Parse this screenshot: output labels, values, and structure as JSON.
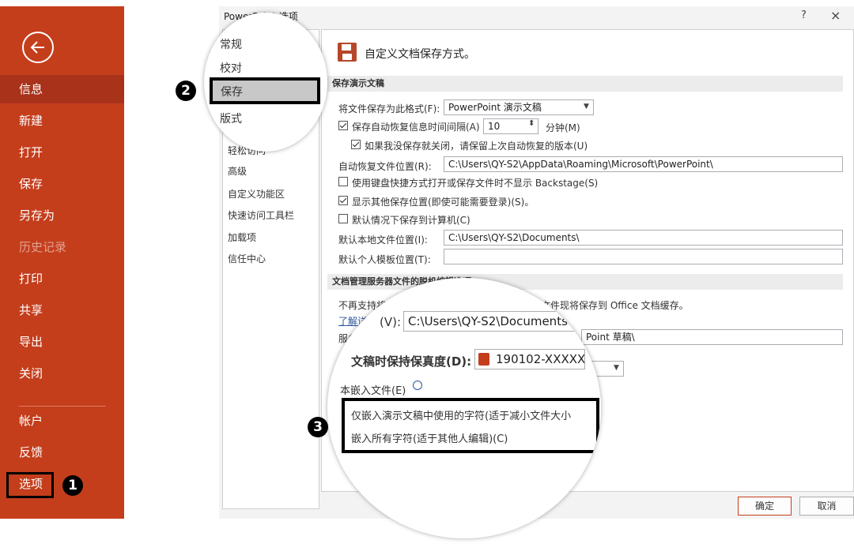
{
  "sidebar": {
    "back_icon": "arrow-left-circle-icon",
    "items": [
      {
        "label": "信息",
        "state": "active"
      },
      {
        "label": "新建"
      },
      {
        "label": "打开"
      },
      {
        "label": "保存"
      },
      {
        "label": "另存为"
      },
      {
        "label": "历史记录",
        "state": "disabled"
      },
      {
        "label": "打印"
      },
      {
        "label": "共享"
      },
      {
        "label": "导出"
      },
      {
        "label": "关闭"
      },
      {
        "label": "帐户"
      },
      {
        "label": "反馈"
      },
      {
        "label": "选项",
        "state": "highlighted"
      }
    ],
    "accent_color": "#c43e1c"
  },
  "dialog": {
    "title": "PowerPoint 选项",
    "help": "?",
    "close": "×",
    "categories": [
      "常规",
      "校对",
      "保存",
      "版式",
      "轻松访问",
      "高级",
      "自定义功能区",
      "快速访问工具栏",
      "加载项",
      "信任中心"
    ],
    "heading": "自定义文档保存方式。",
    "section_save": "保存演示文稿",
    "format_label": "将文件保存为此格式(F):",
    "format_value": "PowerPoint 演示文稿",
    "autorecover_label": "保存自动恢复信息时间间隔(A)",
    "autorecover_value": "10",
    "minutes_label": "分钟(M)",
    "keep_last_label": "如果我没保存就关闭，请保留上次自动恢复的版本(U)",
    "autorecover_path_label": "自动恢复文件位置(R):",
    "autorecover_path": "C:\\Users\\QY-S2\\AppData\\Roaming\\Microsoft\\PowerPoint\\",
    "no_backstage_label": "使用键盘快捷方式打开或保存文件时不显示 Backstage(S)",
    "show_more_label": "显示其他保存位置(即使可能需要登录)(S)。",
    "default_local_label": "默认情况下保存到计算机(C)",
    "default_local_path_label": "默认本地文件位置(I):",
    "default_local_path": "C:\\Users\\QY-S2\\Documents\\",
    "template_path_label": "默认个人模板位置(T):",
    "template_path": "",
    "section_server": "文档管理服务器文件的脱机编辑选项",
    "server_note_prefix": "不再支持将",
    "server_note_suffix": "文件现将保存到 Office 文档缓存。",
    "learn_more": "了解详细",
    "server_drafts_label": "服务",
    "server_drafts_value": "Point 草稿\\",
    "ok": "确定",
    "cancel": "取消"
  },
  "magnifier_top": {
    "items": [
      "常规",
      "校对",
      "保存",
      "版式"
    ]
  },
  "magnifier_bottom": {
    "path_label": "(V):",
    "path_value": "C:\\Users\\QY-S2\\Documents",
    "fidelity_label": "文稿时保持保真度(D):",
    "fidelity_value": "190102-XXXXX",
    "embed_label": "本嵌入文件(E)",
    "embed_option_1": "仅嵌入演示文稿中使用的字符(适于减小文件大小",
    "embed_option_2": "嵌入所有字符(适于其他人编辑)(C)"
  },
  "badges": [
    "1",
    "2",
    "3"
  ]
}
